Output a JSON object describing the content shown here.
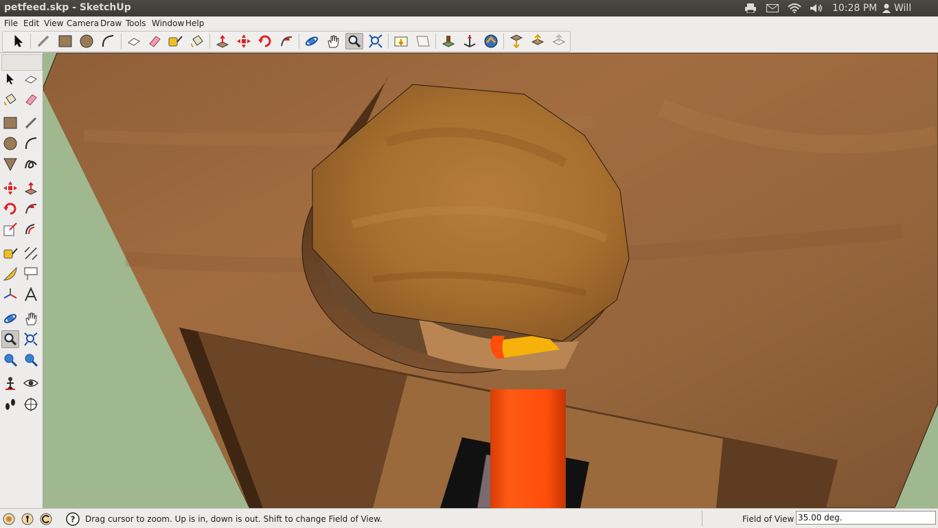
{
  "window": {
    "title": "petfeed.skp - SketchUp"
  },
  "panel": {
    "tray": [
      "printer-icon",
      "mail-icon",
      "wifi-icon",
      "volume-icon"
    ],
    "clock": "10:28 PM",
    "user": "Will"
  },
  "menubar": {
    "items": [
      {
        "label": "File"
      },
      {
        "label": "Edit"
      },
      {
        "label": "View"
      },
      {
        "label": "Camera"
      },
      {
        "label": "Draw"
      },
      {
        "label": "Tools"
      },
      {
        "label": "Window"
      },
      {
        "label": "Help"
      }
    ]
  },
  "toolbar": {
    "tools": [
      "select-icon",
      "line-icon",
      "rectangle-icon",
      "circle-icon",
      "arc-icon",
      "make-component-icon",
      "eraser-icon",
      "tape-measure-icon",
      "paint-bucket-icon",
      "push-pull-icon",
      "move-icon",
      "rotate-icon",
      "follow-me-icon",
      "orbit-icon",
      "pan-icon",
      "zoom-icon",
      "zoom-extents-icon",
      "previous-view-icon",
      "next-view-icon",
      "add-location-icon",
      "toggle-terrain-icon",
      "google-earth-icon",
      "get-models-icon",
      "share-model-icon",
      "share-component-icon"
    ],
    "active": "zoom-icon"
  },
  "palette": {
    "active": "zoom-tool"
  },
  "status": {
    "text": "Drag cursor to zoom.  Up is in, down is out. Shift to change Field of View.",
    "vcb_label": "Field of View",
    "vcb_value": "35.00 deg."
  },
  "colors": {
    "wood": "#9a6a3e",
    "ground": "#9fb890",
    "cylinder": "#ff4d0a",
    "yellow": "#f6b20a"
  }
}
